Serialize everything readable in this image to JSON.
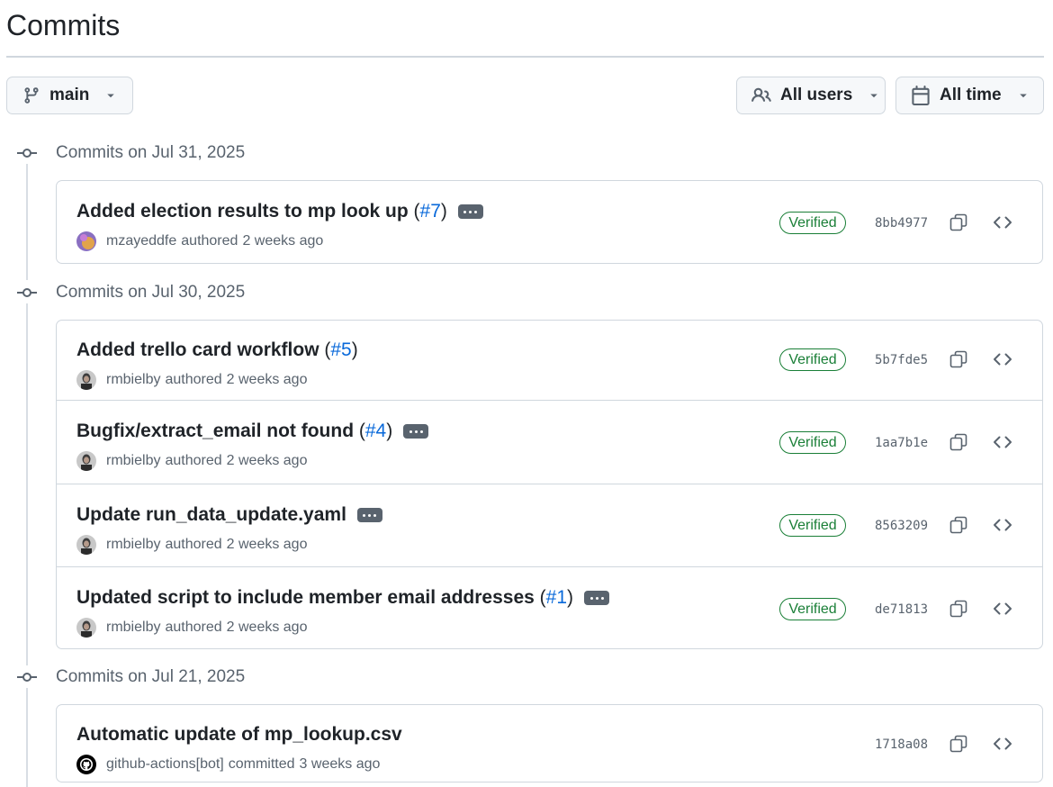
{
  "page": {
    "title": "Commits"
  },
  "filters": {
    "branch": {
      "label": "main",
      "icon": "git-branch-icon"
    },
    "users": {
      "label": "All users",
      "icon": "people-icon"
    },
    "time": {
      "label": "All time",
      "icon": "calendar-icon"
    }
  },
  "groups": [
    {
      "date_label": "Commits on Jul 31, 2025",
      "commits": [
        {
          "message": "Added election results to mp look up",
          "pr": "#7",
          "has_more": true,
          "author": "mzayeddfe",
          "verb": "authored",
          "when": "2 weeks ago",
          "verified": "Verified",
          "sha": "8bb4977"
        }
      ]
    },
    {
      "date_label": "Commits on Jul 30, 2025",
      "commits": [
        {
          "message": "Added trello card workflow",
          "pr": "#5",
          "has_more": false,
          "author": "rmbielby",
          "verb": "authored",
          "when": "2 weeks ago",
          "verified": "Verified",
          "sha": "5b7fde5"
        },
        {
          "message": "Bugfix/extract_email not found",
          "pr": "#4",
          "has_more": true,
          "author": "rmbielby",
          "verb": "authored",
          "when": "2 weeks ago",
          "verified": "Verified",
          "sha": "1aa7b1e"
        },
        {
          "message": "Update run_data_update.yaml",
          "pr": "",
          "has_more": true,
          "author": "rmbielby",
          "verb": "authored",
          "when": "2 weeks ago",
          "verified": "Verified",
          "sha": "8563209"
        },
        {
          "message": "Updated script to include member email addresses",
          "pr": "#1",
          "has_more": true,
          "author": "rmbielby",
          "verb": "authored",
          "when": "2 weeks ago",
          "verified": "Verified",
          "sha": "de71813"
        }
      ]
    },
    {
      "date_label": "Commits on Jul 21, 2025",
      "commits": [
        {
          "message": "Automatic update of mp_lookup.csv",
          "pr": "",
          "has_more": false,
          "author": "github-actions[bot]",
          "verb": "committed",
          "when": "3 weeks ago",
          "verified": "",
          "sha": "1718a08"
        }
      ]
    }
  ],
  "colors": {
    "link": "#0969da",
    "verified": "#1a7f37",
    "muted": "#59636e",
    "border": "#d0d7de"
  }
}
